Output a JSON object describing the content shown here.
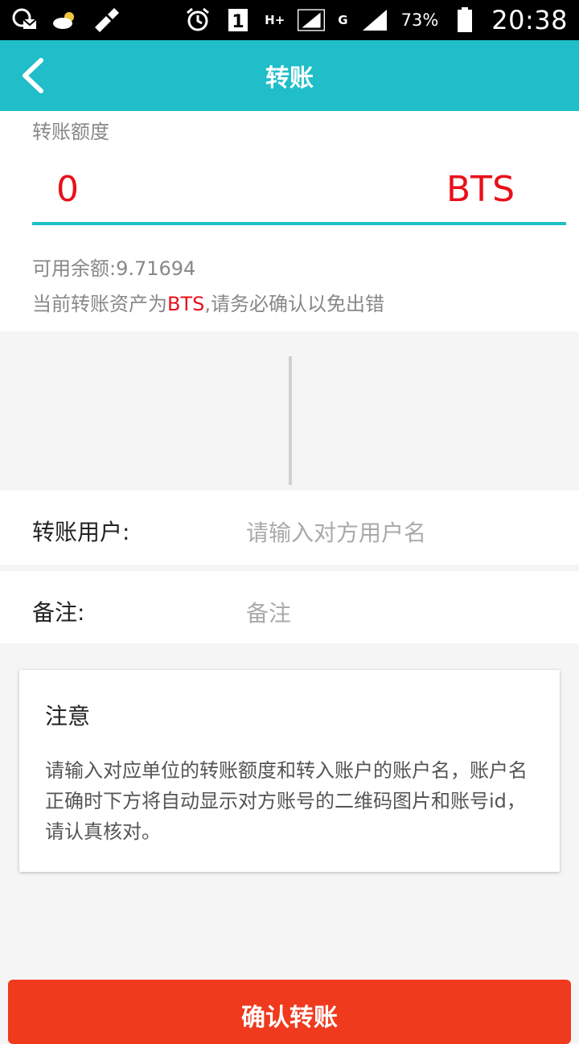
{
  "status_bar": {
    "sim_label": "1",
    "network_type": "H+",
    "network_type_2": "G",
    "battery_percent": "73%",
    "time": "20:38"
  },
  "header": {
    "title": "转账"
  },
  "amount": {
    "label": "转账额度",
    "value": "0",
    "unit": "BTS",
    "balance": "可用余额:9.71694",
    "hint_prefix": "当前转账资产为",
    "hint_asset": "BTS",
    "hint_suffix": ",请务必确认以免出错"
  },
  "recipient": {
    "label": "转账用户:",
    "placeholder": "请输入对方用户名"
  },
  "memo": {
    "label": "备注:",
    "placeholder": "备注"
  },
  "notice": {
    "title": "注意",
    "body": "请输入对应单位的转账额度和转入账户的账户名，账户名正确时下方将自动显示对方账号的二维码图片和账号id，请认真核对。"
  },
  "confirm": {
    "label": "确认转账"
  },
  "colors": {
    "accent": "#1fbec8",
    "alert_red": "#e8101a",
    "button_red": "#ef3a1e"
  }
}
